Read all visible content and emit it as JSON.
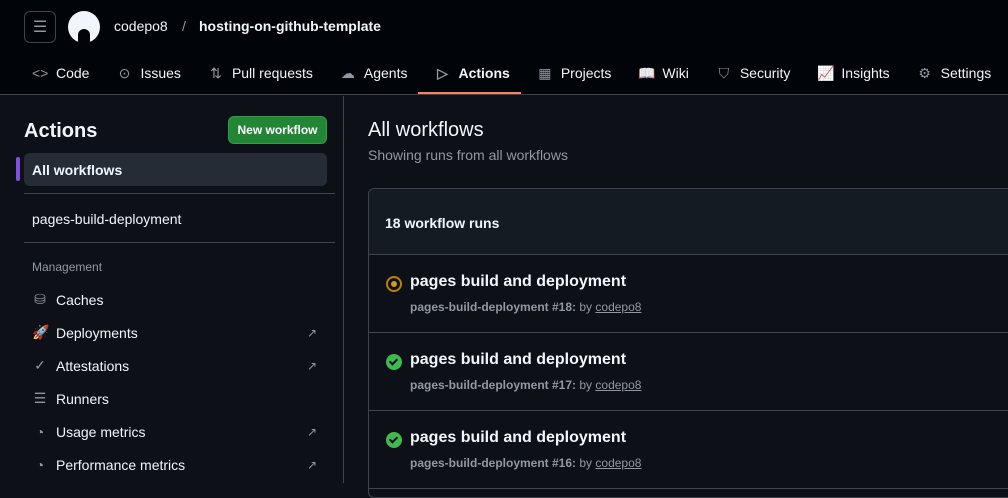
{
  "header": {
    "owner": "codepo8",
    "separator": "/",
    "repo": "hosting-on-github-template"
  },
  "tabs": [
    {
      "label": "Code",
      "icon": "code-icon",
      "glyph": "<>"
    },
    {
      "label": "Issues",
      "icon": "issue-icon",
      "glyph": "⊙"
    },
    {
      "label": "Pull requests",
      "icon": "pull-request-icon",
      "glyph": "⇅"
    },
    {
      "label": "Agents",
      "icon": "cloud-agent-icon",
      "glyph": "☁"
    },
    {
      "label": "Actions",
      "icon": "play-icon",
      "glyph": "▷",
      "active": true
    },
    {
      "label": "Projects",
      "icon": "table-icon",
      "glyph": "▦"
    },
    {
      "label": "Wiki",
      "icon": "book-icon",
      "glyph": "📖"
    },
    {
      "label": "Security",
      "icon": "shield-icon",
      "glyph": "⛉"
    },
    {
      "label": "Insights",
      "icon": "graph-icon",
      "glyph": "📈"
    },
    {
      "label": "Settings",
      "icon": "gear-icon",
      "glyph": "⚙"
    }
  ],
  "sidebar": {
    "title": "Actions",
    "new_workflow": "New workflow",
    "all_workflows": "All workflows",
    "workflow": "pages-build-deployment",
    "management_label": "Management",
    "items": [
      {
        "label": "Caches",
        "icon": "database-icon",
        "glyph": "⛁",
        "external": false
      },
      {
        "label": "Deployments",
        "icon": "rocket-icon",
        "glyph": "🚀",
        "external": true
      },
      {
        "label": "Attestations",
        "icon": "verified-icon",
        "glyph": "✓",
        "external": true
      },
      {
        "label": "Runners",
        "icon": "server-icon",
        "glyph": "☰",
        "external": false
      },
      {
        "label": "Usage metrics",
        "icon": "meter-icon",
        "glyph": "◔",
        "external": true
      },
      {
        "label": "Performance metrics",
        "icon": "meter-icon",
        "glyph": "◔",
        "external": true
      }
    ],
    "external_glyph": "↗"
  },
  "main": {
    "title": "All workflows",
    "subtitle": "Showing runs from all workflows",
    "runs_count": "18 workflow runs",
    "runs": [
      {
        "title": "pages build and deployment",
        "workflow": "pages-build-deployment #18:",
        "by": "by",
        "user": "codepo8",
        "status": "in-progress"
      },
      {
        "title": "pages build and deployment",
        "workflow": "pages-build-deployment #17:",
        "by": "by",
        "user": "codepo8",
        "status": "success"
      },
      {
        "title": "pages build and deployment",
        "workflow": "pages-build-deployment #16:",
        "by": "by",
        "user": "codepo8",
        "status": "success"
      }
    ]
  },
  "colors": {
    "accent_tab": "#f78166",
    "primary_button": "#238636",
    "success": "#3fb950",
    "in_progress": "#d29922",
    "selected_marker": "#8250df"
  }
}
